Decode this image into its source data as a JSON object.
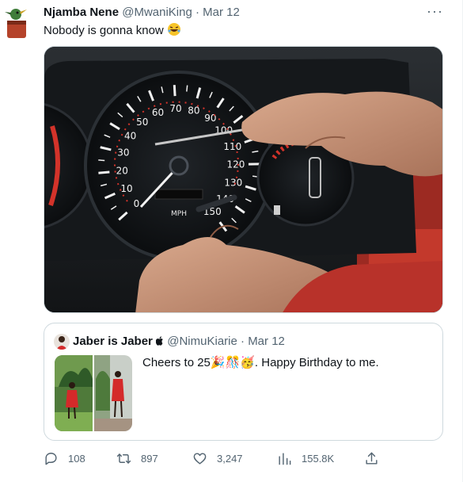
{
  "tweet": {
    "author_name": "Njamba Nene",
    "author_handle": "@MwaniKing",
    "separator": "·",
    "date": "Mar 12",
    "more_label": "···",
    "text": "Nobody is gonna know",
    "text_emoji": "🤣"
  },
  "quote": {
    "author_name": "Jaber is Jaber",
    "author_handle": "@NimuKiarie",
    "separator": "·",
    "date": "Mar 12",
    "text_start": "Cheers to 25",
    "text_emojis": "🎉🎊🥳",
    "text_end": ". Happy Birthday to me."
  },
  "gauge": {
    "speed_ticks": [
      "0",
      "10",
      "20",
      "30",
      "40",
      "50",
      "60",
      "70",
      "80",
      "90",
      "100",
      "110",
      "120",
      "130",
      "140",
      "150"
    ],
    "unit": "MPH"
  },
  "actions": {
    "replies": "108",
    "retweets": "897",
    "likes": "3,247",
    "views": "155.8K"
  },
  "icons": {
    "more": "more-options-icon",
    "reply": "reply-icon",
    "retweet": "retweet-icon",
    "like": "heart-icon",
    "views": "views-chart-icon",
    "share": "share-icon",
    "apple": "apple-logo-icon"
  },
  "colors": {
    "muted": "#536471",
    "text": "#0f1419",
    "border": "#cfd9de",
    "screwdriver": "#e2421a"
  }
}
